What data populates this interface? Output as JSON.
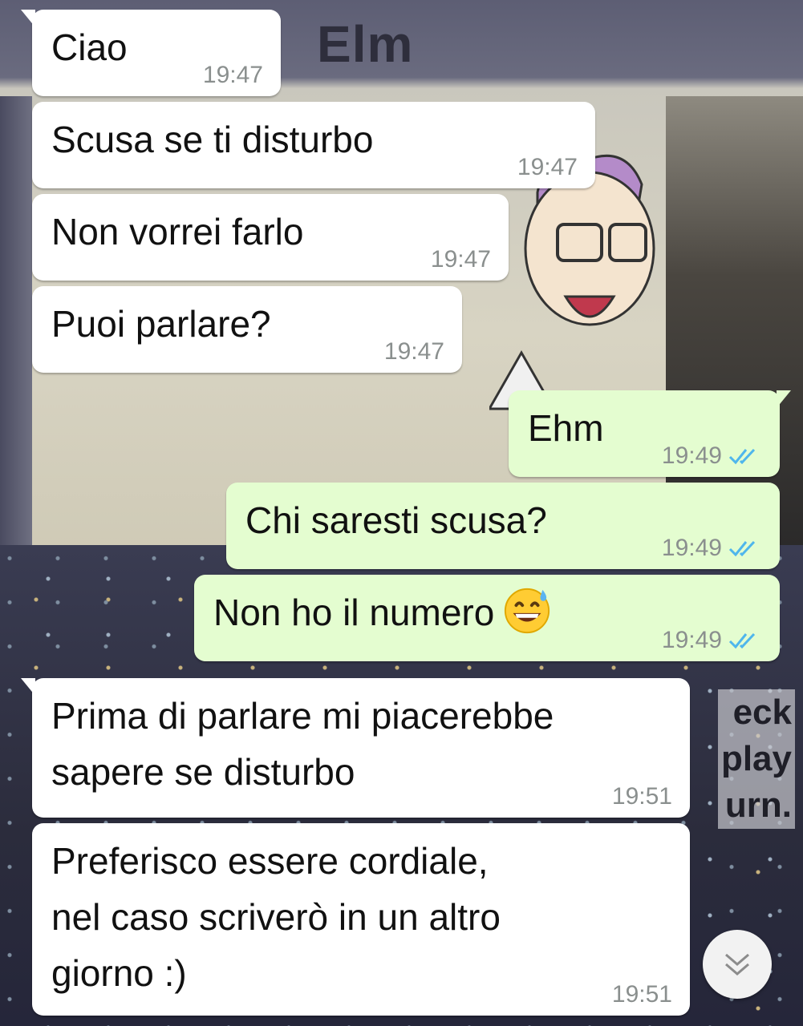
{
  "wallpaper": {
    "title_fragment": "Elm",
    "side_text": [
      "eck",
      "play",
      "urn."
    ]
  },
  "colors": {
    "incoming_bubble": "#ffffff",
    "outgoing_bubble": "#e4fdd0",
    "timestamp": "#8a8f8e",
    "read_ticks": "#4fb6ec"
  },
  "messages": [
    {
      "direction": "in",
      "text": "Ciao",
      "time": "19:47"
    },
    {
      "direction": "in",
      "text": "Scusa se ti disturbo",
      "time": "19:47"
    },
    {
      "direction": "in",
      "text": "Non vorrei farlo",
      "time": "19:47"
    },
    {
      "direction": "in",
      "text": "Puoi parlare?",
      "time": "19:47"
    },
    {
      "direction": "out",
      "text": "Ehm",
      "time": "19:49",
      "status": "read"
    },
    {
      "direction": "out",
      "text": "Chi saresti scusa?",
      "time": "19:49",
      "status": "read"
    },
    {
      "direction": "out",
      "text": "Non ho il numero",
      "emoji": "grinning-sweat-emoji",
      "time": "19:49",
      "status": "read"
    },
    {
      "direction": "in",
      "text": "Prima di parlare mi piacerebbe\nsapere se disturbo",
      "time": "19:51"
    },
    {
      "direction": "in",
      "text": "Preferisco essere cordiale,\nnel caso scriverò in un altro\ngiorno :)",
      "time": "19:51"
    }
  ],
  "scroll_button": {
    "icon": "double-chevron-down-icon"
  }
}
